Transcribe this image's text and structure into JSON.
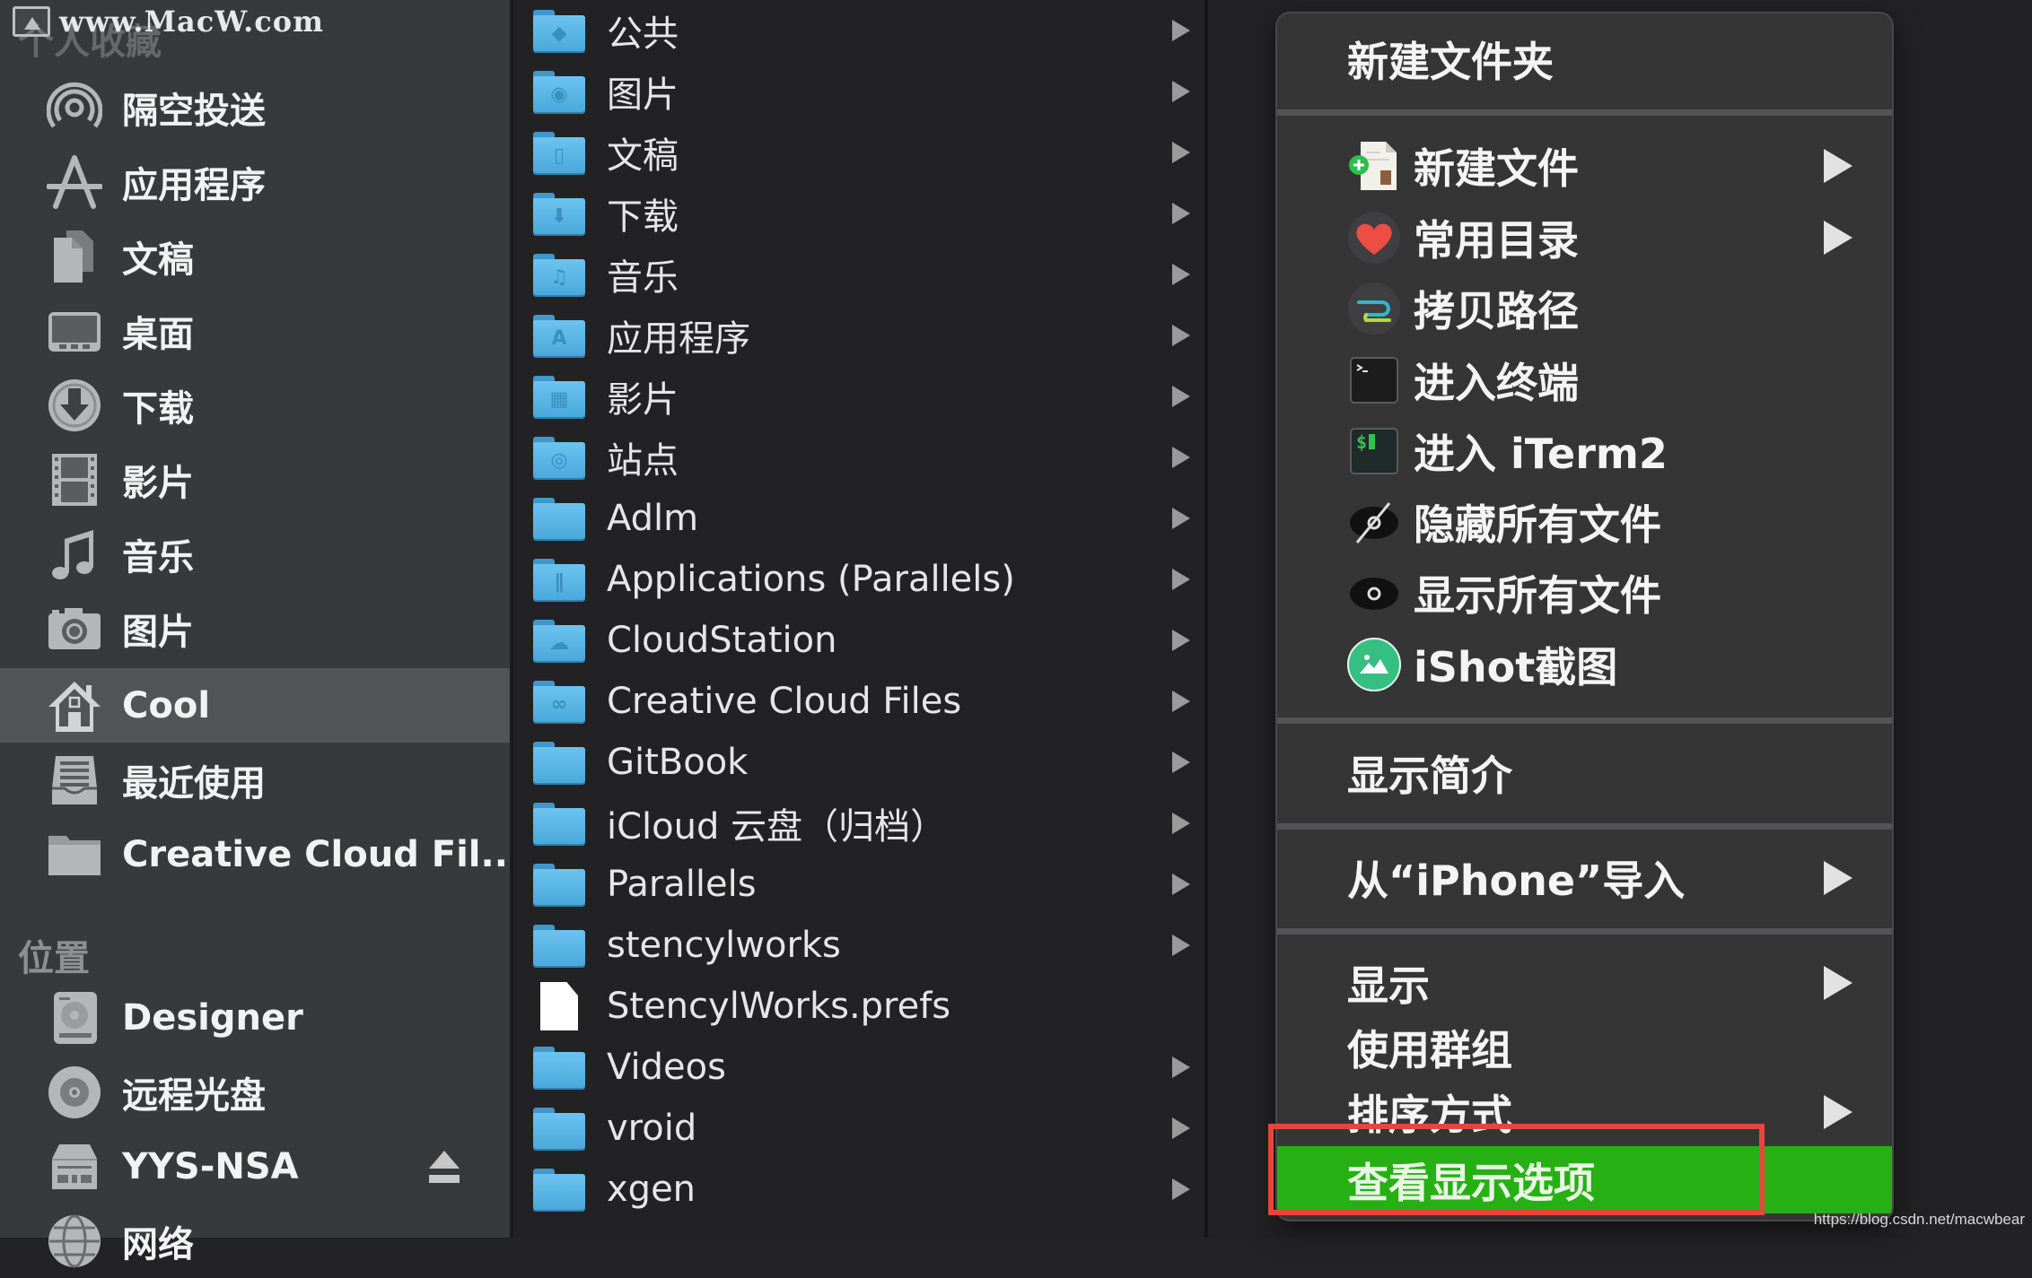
{
  "watermark": {
    "text": "www.MacW.com"
  },
  "sidebar": {
    "favorites_header": "个人收藏",
    "favorites": [
      {
        "label": "隔空投送",
        "icon": "airdrop-icon"
      },
      {
        "label": "应用程序",
        "icon": "applications-icon"
      },
      {
        "label": "文稿",
        "icon": "documents-icon"
      },
      {
        "label": "桌面",
        "icon": "desktop-icon"
      },
      {
        "label": "下载",
        "icon": "downloads-icon"
      },
      {
        "label": "影片",
        "icon": "movies-icon"
      },
      {
        "label": "音乐",
        "icon": "music-icon"
      },
      {
        "label": "图片",
        "icon": "pictures-icon"
      },
      {
        "label": "Cool",
        "icon": "home-icon",
        "selected": true
      },
      {
        "label": "最近使用",
        "icon": "recents-icon"
      },
      {
        "label": "Creative Cloud Fil...",
        "icon": "folder-icon"
      }
    ],
    "locations_header": "位置",
    "locations": [
      {
        "label": "Designer",
        "icon": "hard-drive-icon"
      },
      {
        "label": "远程光盘",
        "icon": "remote-disc-icon"
      },
      {
        "label": "YYS-NSA",
        "icon": "server-icon",
        "ejectable": true
      },
      {
        "label": "网络",
        "icon": "network-icon"
      }
    ]
  },
  "column": {
    "items": [
      {
        "label": "公共",
        "type": "folder",
        "glyph": "◆"
      },
      {
        "label": "图片",
        "type": "folder",
        "glyph": "◉"
      },
      {
        "label": "文稿",
        "type": "folder",
        "glyph": "▯"
      },
      {
        "label": "下载",
        "type": "folder",
        "glyph": "⬇"
      },
      {
        "label": "音乐",
        "type": "folder",
        "glyph": "♫"
      },
      {
        "label": "应用程序",
        "type": "folder",
        "glyph": "A"
      },
      {
        "label": "影片",
        "type": "folder",
        "glyph": "▦"
      },
      {
        "label": "站点",
        "type": "folder",
        "glyph": "◎"
      },
      {
        "label": "Adlm",
        "type": "folder",
        "glyph": ""
      },
      {
        "label": "Applications (Parallels)",
        "type": "folder",
        "glyph": "∥"
      },
      {
        "label": "CloudStation",
        "type": "folder",
        "glyph": "☁"
      },
      {
        "label": "Creative Cloud Files",
        "type": "folder",
        "glyph": "∞"
      },
      {
        "label": "GitBook",
        "type": "folder",
        "glyph": ""
      },
      {
        "label": "iCloud 云盘（归档）",
        "type": "folder",
        "glyph": ""
      },
      {
        "label": "Parallels",
        "type": "folder",
        "glyph": ""
      },
      {
        "label": "stencylworks",
        "type": "folder",
        "glyph": ""
      },
      {
        "label": "StencylWorks.prefs",
        "type": "file",
        "glyph": ""
      },
      {
        "label": "Videos",
        "type": "folder",
        "glyph": ""
      },
      {
        "label": "vroid",
        "type": "folder",
        "glyph": ""
      },
      {
        "label": "xgen",
        "type": "folder",
        "glyph": ""
      }
    ]
  },
  "context_menu": {
    "new_folder": "新建文件夹",
    "tools": [
      {
        "label": "新建文件",
        "icon": "new-file-icon",
        "submenu": true
      },
      {
        "label": "常用目录",
        "icon": "heart-icon",
        "submenu": true
      },
      {
        "label": "拷贝路径",
        "icon": "copy-path-icon",
        "submenu": false
      },
      {
        "label": "进入终端",
        "icon": "terminal-icon",
        "submenu": false
      },
      {
        "label": "进入 iTerm2",
        "icon": "iterm2-icon",
        "submenu": false
      },
      {
        "label": "隐藏所有文件",
        "icon": "hide-eye-icon",
        "submenu": false
      },
      {
        "label": "显示所有文件",
        "icon": "show-eye-icon",
        "submenu": false
      },
      {
        "label": "iShot截图",
        "icon": "ishot-icon",
        "submenu": false
      }
    ],
    "get_info": "显示简介",
    "import_from_iphone": "从“iPhone”导入",
    "view_group": [
      {
        "label": "显示",
        "submenu": true
      },
      {
        "label": "使用群组",
        "submenu": false
      },
      {
        "label": "排序方式",
        "submenu": true
      }
    ],
    "show_view_options": "查看显示选项",
    "highlight_color": "#26b014",
    "annotation_color": "#e8463c"
  },
  "credit": "https://blog.csdn.net/macwbear"
}
